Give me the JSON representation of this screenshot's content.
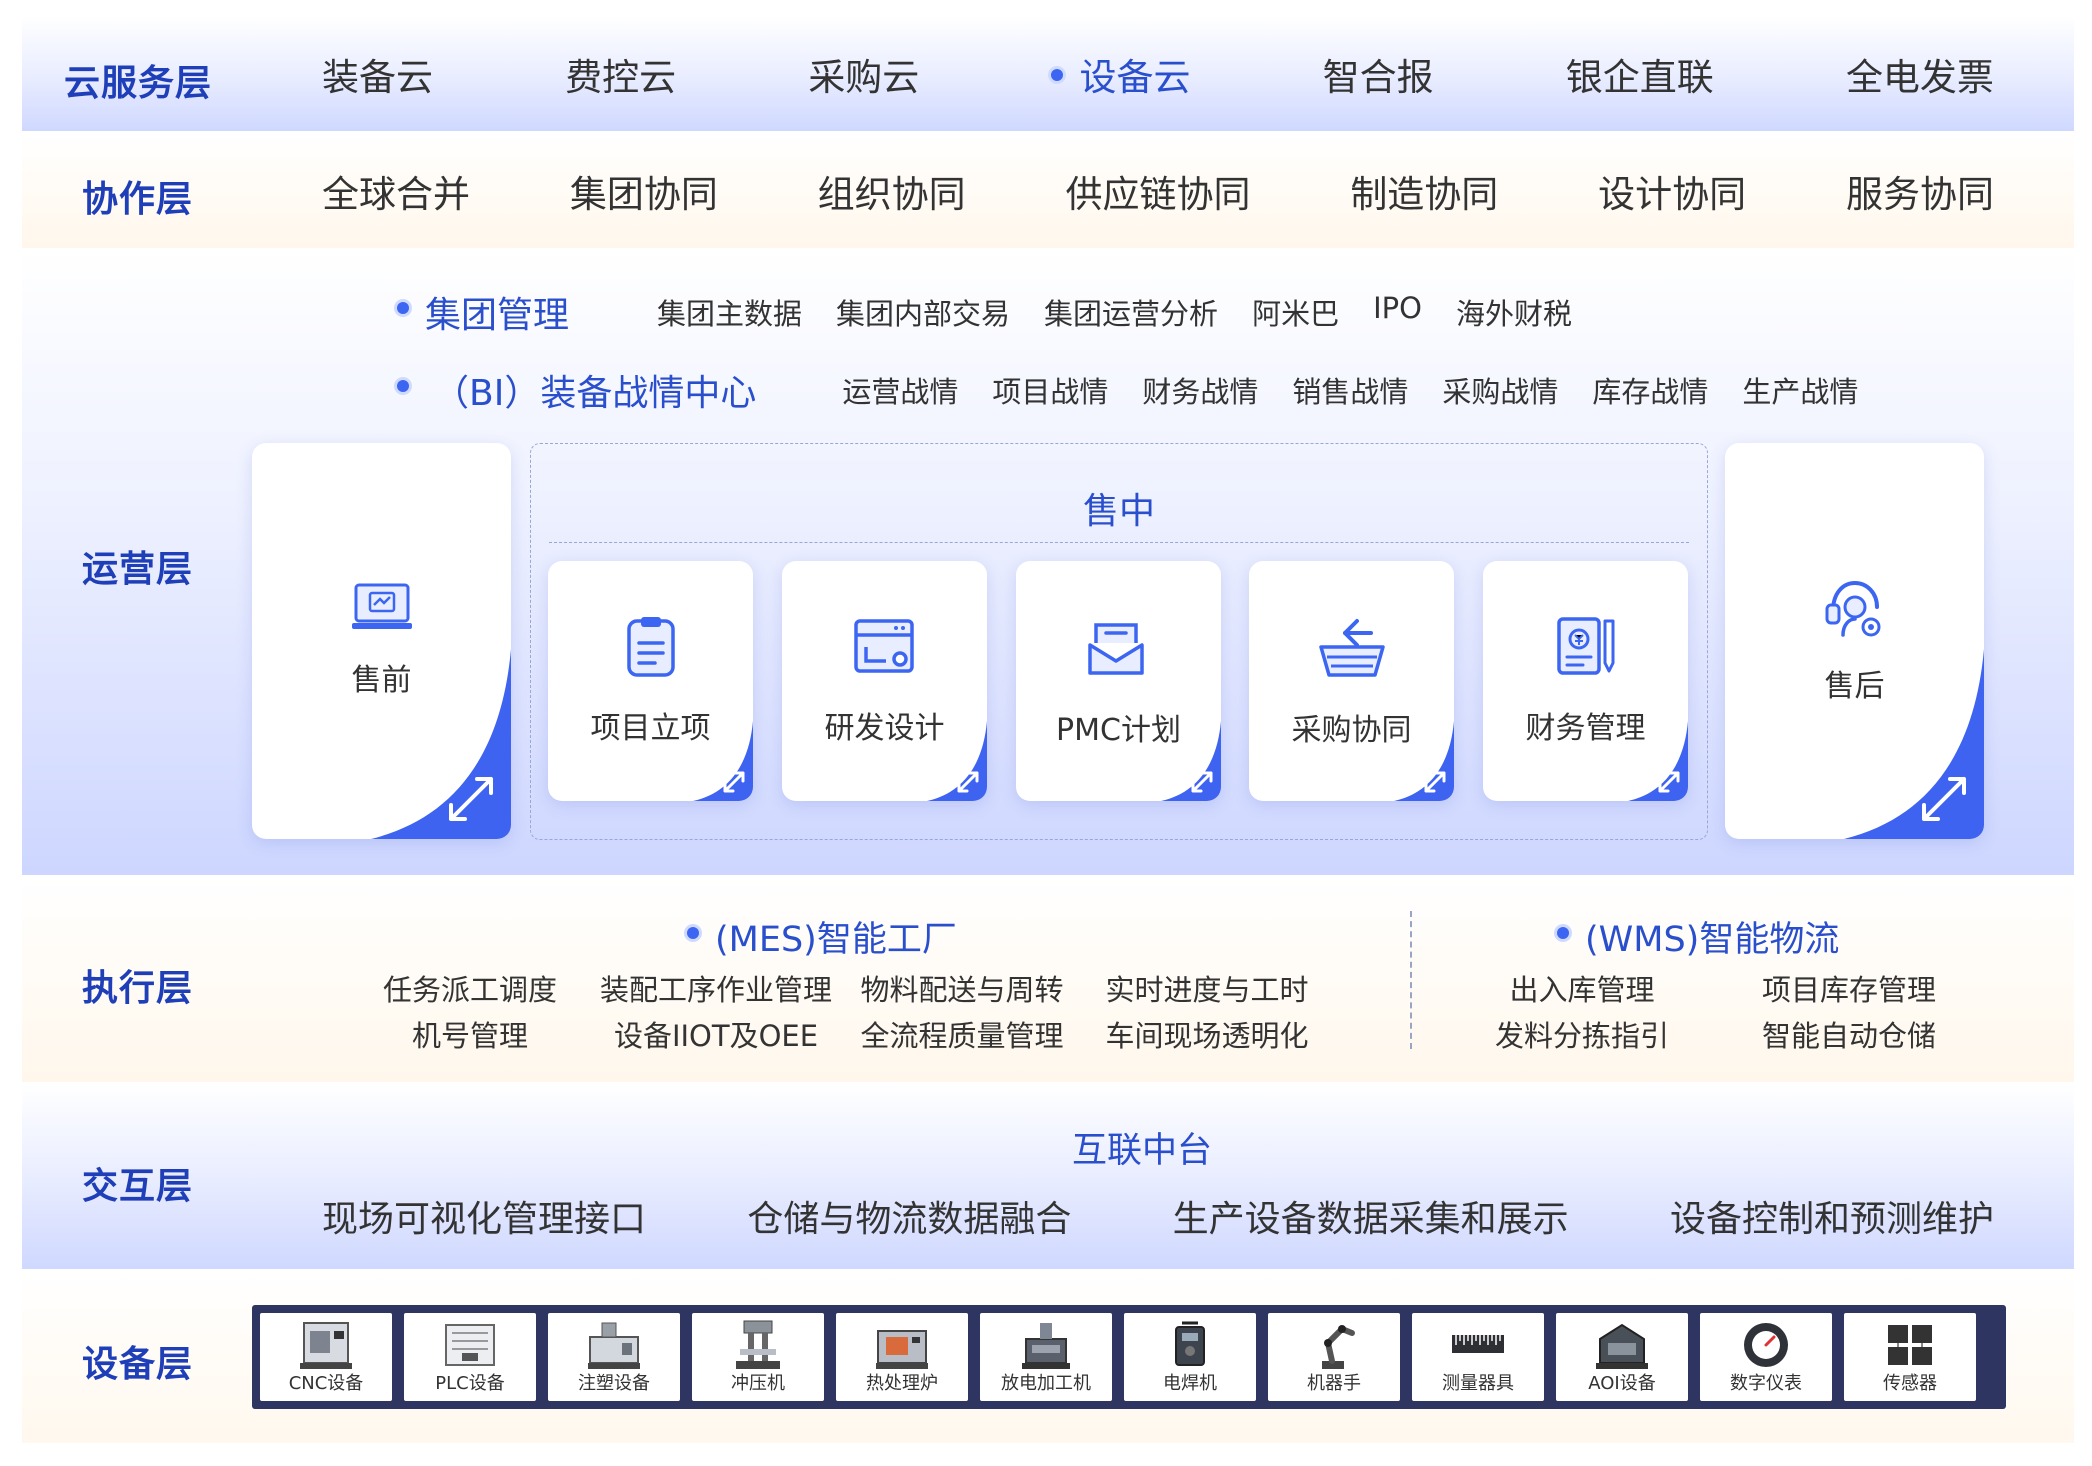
{
  "layers": {
    "cloud": {
      "title": "云服务层",
      "items": [
        "装备云",
        "费控云",
        "采购云",
        "设备云",
        "智合报",
        "银企直联",
        "全电发票"
      ],
      "active_index": 3
    },
    "collab": {
      "title": "协作层",
      "items": [
        "全球合并",
        "集团协同",
        "组织协同",
        "供应链协同",
        "制造协同",
        "设计协同",
        "服务协同"
      ]
    },
    "ops": {
      "title": "运营层",
      "group": {
        "head": "集团管理",
        "items": [
          "集团主数据",
          "集团内部交易",
          "集团运营分析",
          "阿米巴",
          "IPO",
          "海外财税"
        ]
      },
      "bi": {
        "head": "（BI）装备战情中心",
        "items": [
          "运营战情",
          "项目战情",
          "财务战情",
          "销售战情",
          "采购战情",
          "库存战情",
          "生产战情"
        ]
      },
      "presale": {
        "label": "售前",
        "icon": "monitor-icon"
      },
      "insale": {
        "title": "售中",
        "cards": [
          {
            "label": "项目立项",
            "icon": "clipboard-icon"
          },
          {
            "label": "研发设计",
            "icon": "design-window-icon"
          },
          {
            "label": "PMC计划",
            "icon": "mail-tray-icon"
          },
          {
            "label": "采购协同",
            "icon": "basket-icon"
          },
          {
            "label": "财务管理",
            "icon": "finance-doc-icon"
          }
        ]
      },
      "aftersale": {
        "label": "售后",
        "icon": "support-gear-icon"
      }
    },
    "exec": {
      "title": "执行层",
      "mes": {
        "head": "(MES)智能工厂",
        "row1": [
          "任务派工调度",
          "装配工序作业管理",
          "物料配送与周转",
          "实时进度与工时"
        ],
        "row2": [
          "机号管理",
          "设备IIOT及OEE",
          "全流程质量管理",
          "车间现场透明化"
        ]
      },
      "wms": {
        "head": "(WMS)智能物流",
        "row1": [
          "出入库管理",
          "项目库存管理"
        ],
        "row2": [
          "发料分拣指引",
          "智能自动仓储"
        ]
      }
    },
    "inter": {
      "title": "交互层",
      "center": "互联中台",
      "items": [
        "现场可视化管理接口",
        "仓储与物流数据融合",
        "生产设备数据采集和展示",
        "设备控制和预测维护"
      ]
    },
    "dev": {
      "title": "设备层",
      "devices": [
        "CNC设备",
        "PLC设备",
        "注塑设备",
        "冲压机",
        "热处理炉",
        "放电加工机",
        "电焊机",
        "机器手",
        "测量器具",
        "AOI设备",
        "数字仪表",
        "传感器"
      ]
    }
  },
  "colors": {
    "accent": "#3c66f2",
    "title": "#1f3fb8",
    "corner": "#3d63f0"
  }
}
